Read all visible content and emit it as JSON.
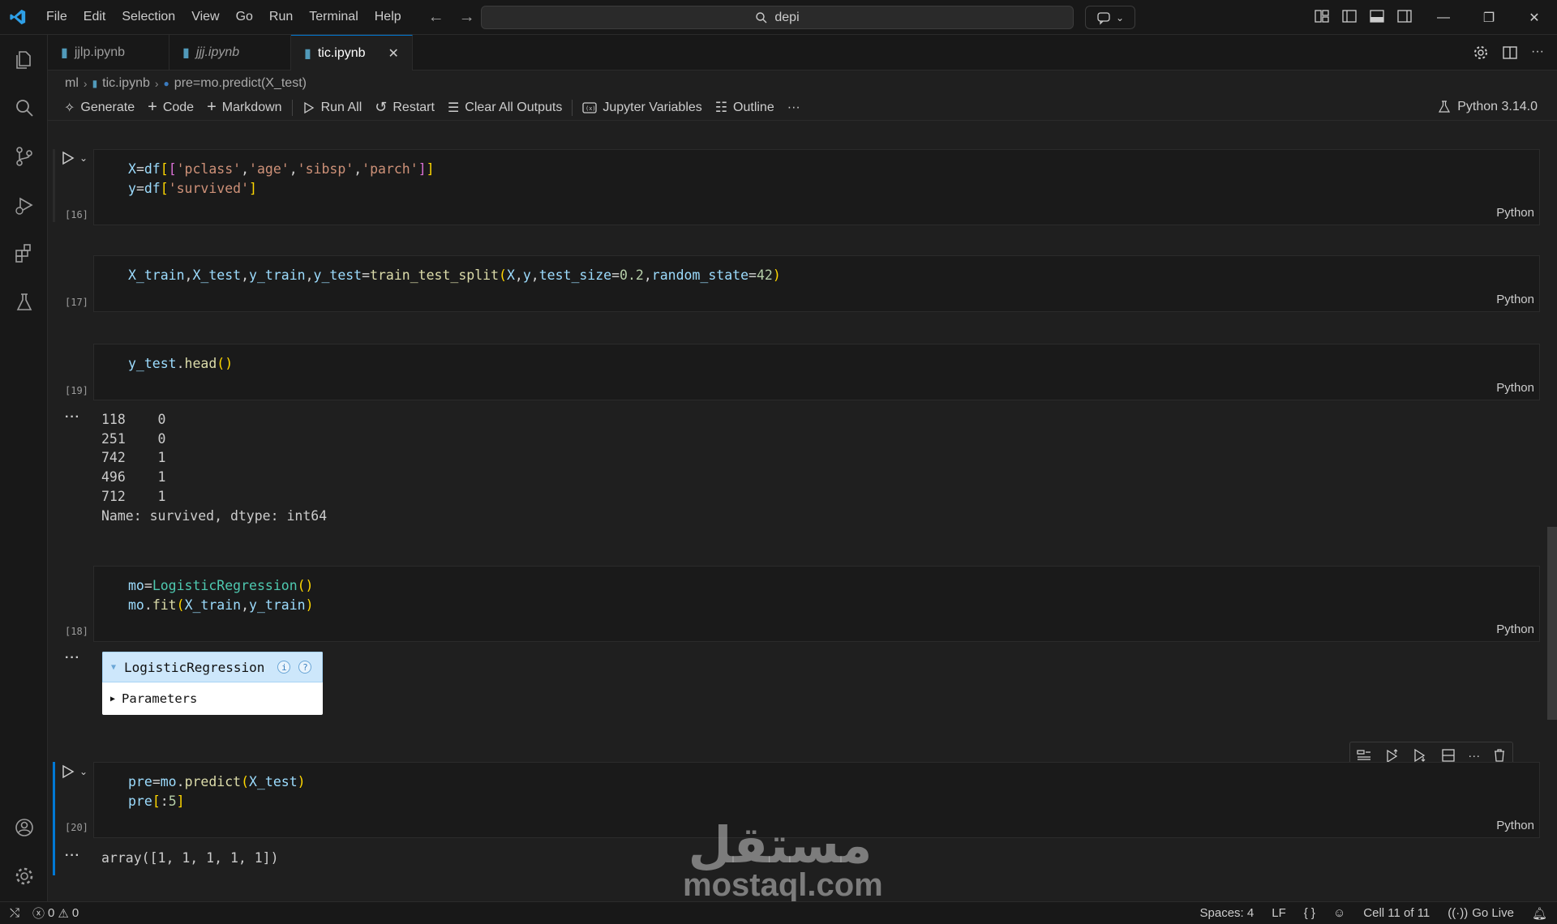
{
  "titlebar": {
    "menu": [
      "File",
      "Edit",
      "Selection",
      "View",
      "Go",
      "Run",
      "Terminal",
      "Help"
    ],
    "search_text": "depi"
  },
  "tabs": [
    {
      "label": "jjlp.ipynb",
      "italic": false,
      "active": false
    },
    {
      "label": "jjj.ipynb",
      "italic": true,
      "active": false
    },
    {
      "label": "tic.ipynb",
      "italic": false,
      "active": true
    }
  ],
  "breadcrumb": [
    "ml",
    "tic.ipynb",
    "pre=mo.predict(X_test)"
  ],
  "toolbar": {
    "generate": "Generate",
    "code": "Code",
    "markdown": "Markdown",
    "run_all": "Run All",
    "restart": "Restart",
    "clear_outputs": "Clear All Outputs",
    "variables": "Jupyter Variables",
    "outline": "Outline",
    "more": "···",
    "kernel": "Python 3.14.0"
  },
  "cells": [
    {
      "count": "[16]",
      "lang": "Python"
    },
    {
      "count": "[17]",
      "lang": "Python"
    },
    {
      "count": "[19]",
      "lang": "Python"
    },
    {
      "count": "[18]",
      "lang": "Python"
    },
    {
      "count": "[20]",
      "lang": "Python"
    }
  ],
  "outputs": {
    "ellipsis": "···",
    "series": [
      "118    0",
      "251    0",
      "742    1",
      "496    1",
      "712    1",
      "Name: survived, dtype: int64"
    ],
    "lr_title": "LogisticRegression",
    "lr_info": "i",
    "lr_help": "?",
    "lr_params": "Parameters",
    "array": "array([1, 1, 1, 1, 1])"
  },
  "statusbar": {
    "errors": "0",
    "warnings": "0",
    "spaces": "Spaces: 4",
    "eol": "LF",
    "braces": "{ }",
    "cell": "Cell 11 of 11",
    "golive": "Go Live"
  },
  "watermark": {
    "arabic": "مستقل",
    "latin": "mostaql.com"
  },
  "colors": {
    "accent": "#0078d4",
    "editor_bg": "#1f1f1f",
    "cell_bg": "#1a1a1a"
  }
}
